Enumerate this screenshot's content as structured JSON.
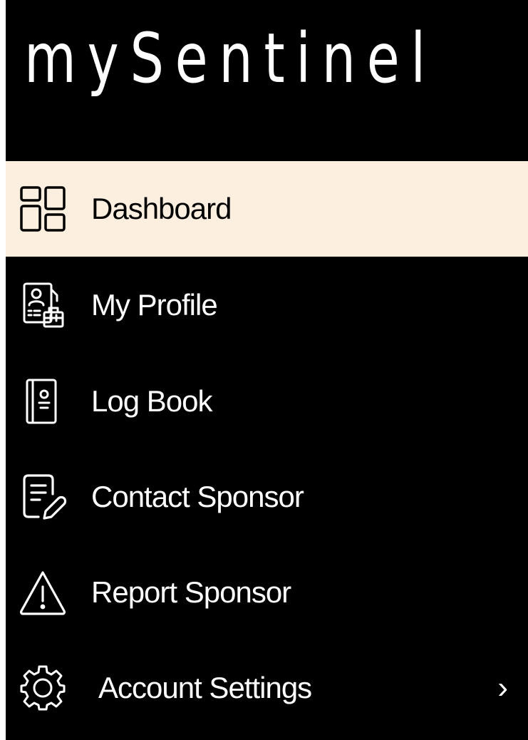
{
  "app": {
    "logo_text": "mySentinel"
  },
  "menu": {
    "items": [
      {
        "label": "Dashboard",
        "icon": "dashboard-icon",
        "active": true
      },
      {
        "label": "My Profile",
        "icon": "profile-icon",
        "active": false
      },
      {
        "label": "Log Book",
        "icon": "logbook-icon",
        "active": false
      },
      {
        "label": "Contact Sponsor",
        "icon": "edit-document-icon",
        "active": false
      },
      {
        "label": "Report Sponsor",
        "icon": "warning-icon",
        "active": false
      },
      {
        "label": "Account Settings",
        "icon": "gear-icon",
        "active": false,
        "chevron": "›"
      }
    ]
  },
  "colors": {
    "background": "#000000",
    "active_background": "#fcefe0",
    "text": "#ffffff",
    "active_text": "#000000"
  }
}
